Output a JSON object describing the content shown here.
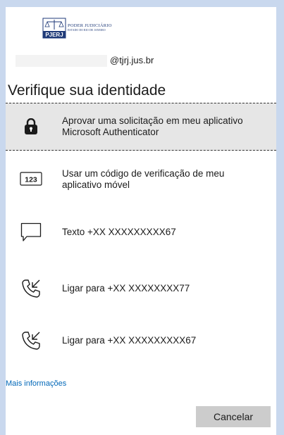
{
  "logo": {
    "badge_text": "PJERJ",
    "line1": "PODER JUDICIÁRIO",
    "line2": "ESTADO DO RIO DE JANEIRO"
  },
  "account": {
    "email_domain": "@tjrj.jus.br"
  },
  "page": {
    "title": "Verifique sua identidade"
  },
  "options": [
    {
      "label": "Aprovar uma solicitação em meu aplicativo Microsoft Authenticator",
      "icon": "lock-icon",
      "selected": true
    },
    {
      "label": "Usar um código de verificação de meu aplicativo móvel",
      "icon": "123-icon",
      "icon_text": "123",
      "selected": false
    },
    {
      "label": "Texto +XX XXXXXXXXX67",
      "icon": "chat-icon",
      "selected": false
    },
    {
      "label": "Ligar para +XX XXXXXXXX77",
      "icon": "phone-icon",
      "selected": false
    },
    {
      "label": "Ligar para +XX XXXXXXXXX67",
      "icon": "phone-icon",
      "selected": false
    }
  ],
  "links": {
    "more_info": "Mais informações"
  },
  "buttons": {
    "cancel": "Cancelar"
  },
  "colors": {
    "background": "#c9d8ee",
    "card": "#ffffff",
    "selected_row": "#e6e6e6",
    "link": "#0067b8",
    "button": "#cccccc",
    "logo": "#1f3a78"
  }
}
